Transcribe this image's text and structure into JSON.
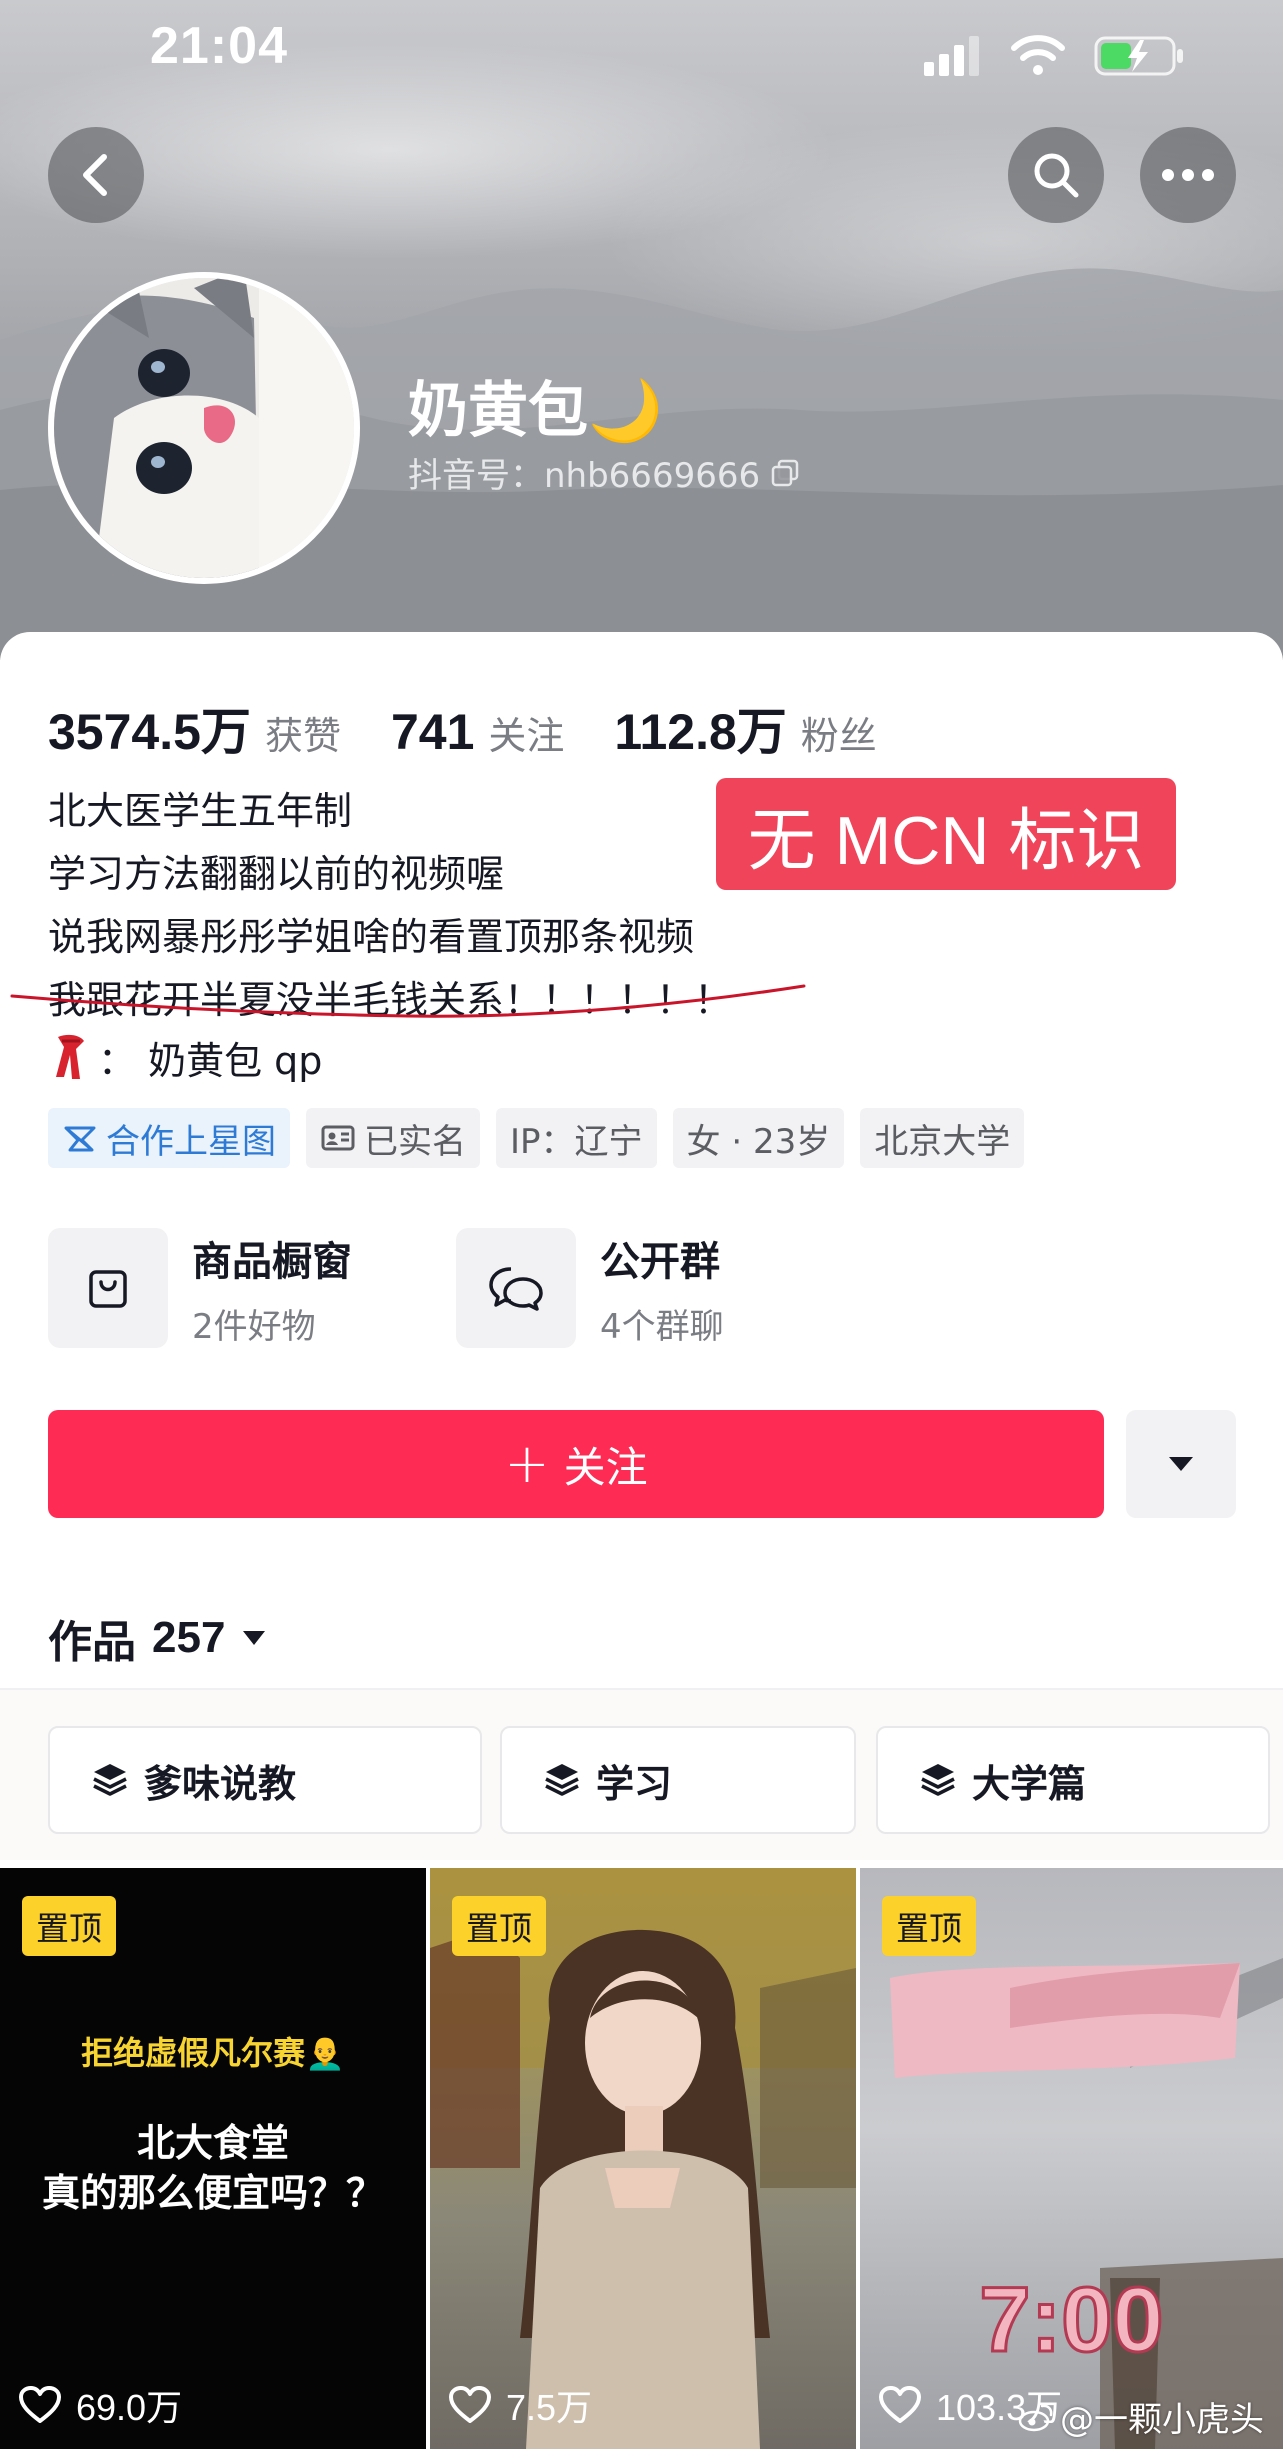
{
  "status_bar": {
    "time": "21:04",
    "icons": [
      "signal-icon",
      "wifi-icon",
      "battery-charging-icon"
    ]
  },
  "header": {
    "buttons": [
      "back-icon",
      "search-icon",
      "more-icon"
    ]
  },
  "profile": {
    "nickname": "奶黄包",
    "nickname_emoji": "🌙",
    "douyin_id": "抖音号：nhb6669666"
  },
  "stats": [
    {
      "value": "3574.5万",
      "label": "获赞"
    },
    {
      "value": "741",
      "label": "关注"
    },
    {
      "value": "112.8万",
      "label": "粉丝"
    }
  ],
  "bio": {
    "lines": [
      "北大医学生五年制",
      "学习方法翻翻以前的视频喔",
      "说我网暴彤彤学姐啥的看置顶那条视频",
      "我跟花开半夏没半毛钱关系！！！！！！"
    ],
    "extra": "：  奶黄包 qp"
  },
  "annotation": {
    "badge_text": "无 MCN 标识",
    "badge_color": "#f0445a",
    "underline_color": "#c9142a"
  },
  "tags": [
    {
      "label": "合作上星图",
      "icon": "star-map-icon"
    },
    {
      "label": "已实名",
      "icon": "id-card-icon"
    },
    {
      "label": "IP：辽宁"
    },
    {
      "label": "女 · 23岁"
    },
    {
      "label": "北京大学"
    }
  ],
  "shortcuts": [
    {
      "title": "商品橱窗",
      "subtitle": "2件好物",
      "icon": "shopping-bag-icon"
    },
    {
      "title": "公开群",
      "subtitle": "4个群聊",
      "icon": "chat-bubbles-icon"
    }
  ],
  "follow": {
    "label": "关注",
    "color": "#fe2c55"
  },
  "works": {
    "label": "作品",
    "count": "257"
  },
  "collections": [
    {
      "label": "爹味说教",
      "icon": "layers-icon"
    },
    {
      "label": "学习",
      "icon": "layers-icon"
    },
    {
      "label": "大学篇",
      "icon": "layers-icon"
    }
  ],
  "videos": [
    {
      "pinned": "置顶",
      "caption_top": "拒绝虚假凡尔赛👨‍🦲",
      "caption_main": "北大食堂\n真的那么便宜吗？？",
      "likes": "69.0万"
    },
    {
      "pinned": "置顶",
      "likes": "7.5万"
    },
    {
      "pinned": "置顶",
      "overlay_text": "7:00",
      "likes": "103.3万"
    }
  ],
  "watermark": "@一颗小虎头"
}
